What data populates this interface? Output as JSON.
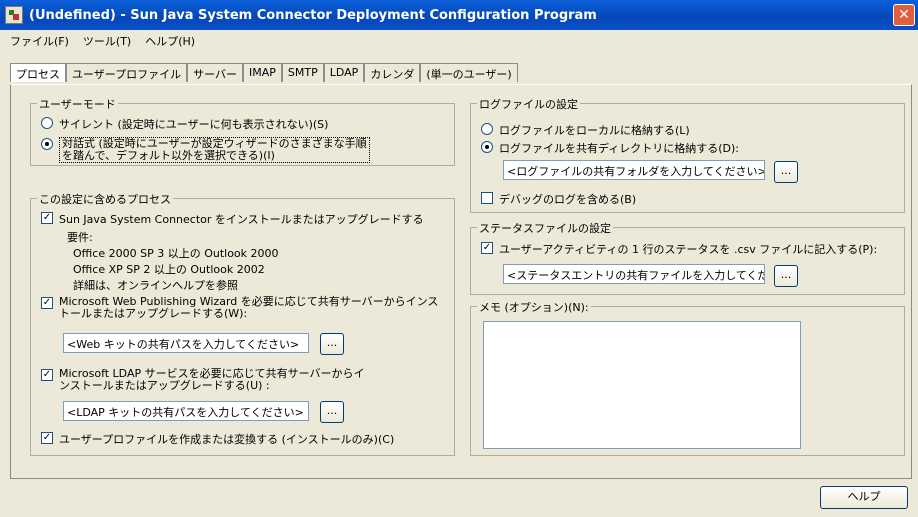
{
  "window": {
    "title": "(Undefined) - Sun Java System Connector Deployment Configuration Program",
    "close": "✕"
  },
  "menu": [
    "ファイル(F)",
    "ツール(T)",
    "ヘルプ(H)"
  ],
  "tabs": [
    "プロセス",
    "ユーザープロファイル",
    "サーバー",
    "IMAP",
    "SMTP",
    "LDAP",
    "カレンダ",
    "(単一のユーザー)"
  ],
  "user_mode": {
    "title": "ユーザーモード",
    "silent": "サイレント (設定時にユーザーに何も表示されない)(S)",
    "interactive_line1": "対話式 (設定時にユーザーが設定ウィザードのさまざまな手順",
    "interactive_line2": "を踏んで、デフォルト以外を選択できる)(I)"
  },
  "processes": {
    "title": "この設定に含めるプロセス",
    "connector": "Sun Java System Connector をインストールまたはアップグレードする",
    "requirements": [
      "要件:",
      "Office 2000 SP 3 以上の Outlook 2000",
      "Office XP SP 2 以上の Outlook 2002",
      "詳細は、オンラインヘルプを参照"
    ],
    "web_line1": "Microsoft Web Publishing Wizard を必要に応じて共有サーバーからインス",
    "web_line2": "トールまたはアップグレードする(W):",
    "web_path": "<Web キットの共有パスを入力してください>",
    "ldap_line1": "Microsoft LDAP サービスを必要に応じて共有サーバーからイ",
    "ldap_line2": "ンストールまたはアップグレードする(U) :",
    "ldap_path": "<LDAP キットの共有パスを入力してください>",
    "profile": "ユーザープロファイルを作成または変換する (インストールのみ)(C)",
    "browse": "..."
  },
  "log_settings": {
    "title": "ログファイルの設定",
    "local": "ログファイルをローカルに格納する(L)",
    "shared": "ログファイルを共有ディレクトリに格納する(D):",
    "path": "<ログファイルの共有フォルダを入力してください>",
    "debug": "デバッグのログを含める(B)"
  },
  "status_settings": {
    "title": "ステータスファイルの設定",
    "record": "ユーザーアクティビティの 1 行のステータスを .csv ファイルに記入する(P):",
    "path": "<ステータスエントリの共有ファイルを入力してください>"
  },
  "memo": {
    "title": "メモ (オプション)(N):"
  },
  "help_button": "ヘルプ"
}
